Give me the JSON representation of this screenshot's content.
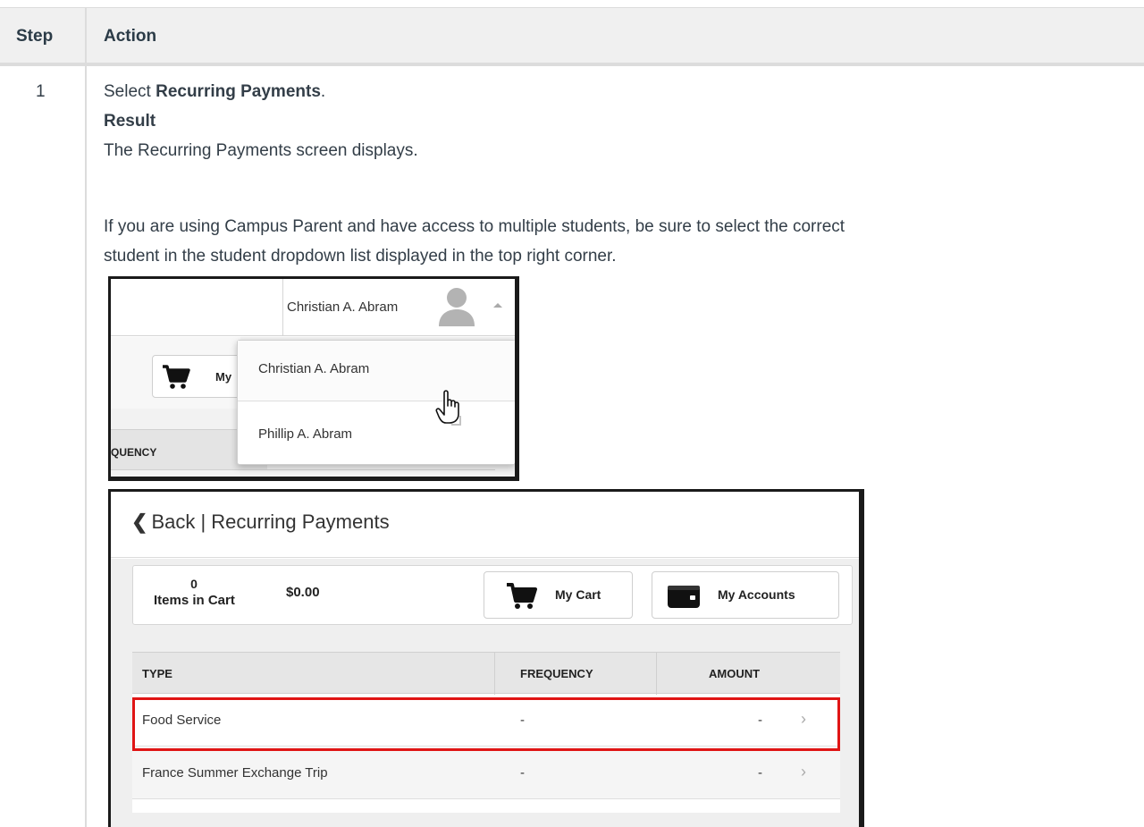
{
  "table": {
    "header_step": "Step",
    "header_action": "Action",
    "step_number": "1"
  },
  "instructions": {
    "select_prefix": "Select ",
    "select_bold": "Recurring Payments",
    "select_suffix": ".",
    "result_label": "Result",
    "result_text": "The Recurring Payments screen displays.",
    "note_line1": "If you are using Campus Parent and have access to multiple students, be sure to select the correct",
    "note_line2": "student in the student dropdown list displayed in the top right corner."
  },
  "screenshot1": {
    "current_student": "Christian A. Abram",
    "cart_label_partial": "My",
    "column_partial": "QUENCY",
    "dropdown_options": [
      "Christian A. Abram",
      "Phillip A. Abram"
    ]
  },
  "screenshot2": {
    "back_label": "Back | Recurring Payments",
    "cart_count": "0",
    "items_in_cart_label": "Items in Cart",
    "cart_total": "$0.00",
    "my_cart_label": "My Cart",
    "my_accounts_label": "My Accounts",
    "columns": [
      "TYPE",
      "FREQUENCY",
      "AMOUNT"
    ],
    "rows": [
      {
        "type": "Food Service",
        "frequency": "-",
        "amount": "-",
        "highlighted": true
      },
      {
        "type": "France Summer Exchange Trip",
        "frequency": "-",
        "amount": "-",
        "highlighted": false
      }
    ],
    "highlight_color": "#e01515"
  }
}
